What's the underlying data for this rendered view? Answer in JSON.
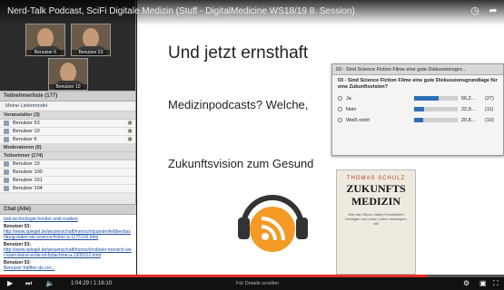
{
  "video": {
    "title": "Nerd-Talk Podcast, SciFi Digitale Medizin (Stuff - DigitalMedicine WS18/19 8. Session)",
    "time": "1:04:29 / 1:16:10",
    "details_label": "Für Details scrollen",
    "progress_fraction": 0.847
  },
  "webcams": [
    {
      "label": "Benutzer 6"
    },
    {
      "label": "Benutzer 53"
    },
    {
      "label": "Benutzer 10"
    }
  ],
  "participants": {
    "header": "Teilnehmerliste (177)",
    "tool": "Meine Listenmodel",
    "groups": [
      {
        "title": "Veranstalter (3)",
        "items": [
          "Benutzer 53",
          "Benutzer 10",
          "Benutzer 6"
        ]
      },
      {
        "title": "Moderatoren (0)",
        "items": []
      },
      {
        "title": "Teilnehmer (174)",
        "items": [
          "Benutzer 10",
          "Benutzer 100",
          "Benutzer 101",
          "Benutzer 104"
        ]
      }
    ]
  },
  "chat": {
    "header": "Chat (Alle)",
    "entries": [
      {
        "who": "",
        "text": "bnb-technologie-frontier-smit-realtext"
      },
      {
        "who": "Benutzer 53:",
        "text": "http://www.spiegel.de/wissenschaft/mensch/quantenfeldbeobachtung-daten-sie-science-fiction-a-1175316.html"
      },
      {
        "who": "Benutzer 53:",
        "text": "http://www.spiegel.de/wissenschaft/mensch/roboter-mensch-wer-kann-keine-ende-ist-bolachme-a-1205012.html"
      },
      {
        "who": "Benutzer 53:",
        "text": "Benutzer fraftfen da vor..."
      }
    ]
  },
  "slide": {
    "title": "Und jetzt ernsthaft",
    "question": "Medizinpodcasts? Welche,",
    "future": "Zukunftsvision zum Gesund"
  },
  "poll": {
    "header": "03 - Sind Science Fiction Filme eine gute Diskussionsgro...",
    "question": "03 - Sind Science Fiction Filme eine gute Diskussionsgrundlage für eine Zukunftsvision?",
    "options": [
      {
        "label": "Ja",
        "pct": "56,2...",
        "count": "(27)",
        "fraction": 0.562
      },
      {
        "label": "Nein",
        "pct": "22,9...",
        "count": "(11)",
        "fraction": 0.229
      },
      {
        "label": "Weiß nicht",
        "pct": "20,8...",
        "count": "(10)",
        "fraction": 0.208
      }
    ]
  },
  "book": {
    "author": "THOMAS SCHULZ",
    "title_line1": "ZUKUNFTS",
    "title_line2": "MEDIZIN",
    "subtitle": "Wie das Silicon Valley Krankheiten besiegen und unser Leben verlängern will"
  },
  "icons": {
    "clock": "clock-icon",
    "share": "share-icon",
    "play": "play-icon",
    "next": "next-icon",
    "volume": "volume-icon",
    "settings": "settings-icon",
    "fullscreen": "fullscreen-icon"
  },
  "colors": {
    "poll_bar": "#2f6fb5",
    "progress": "#e52d27",
    "podcast_logo": "#f49a25"
  }
}
